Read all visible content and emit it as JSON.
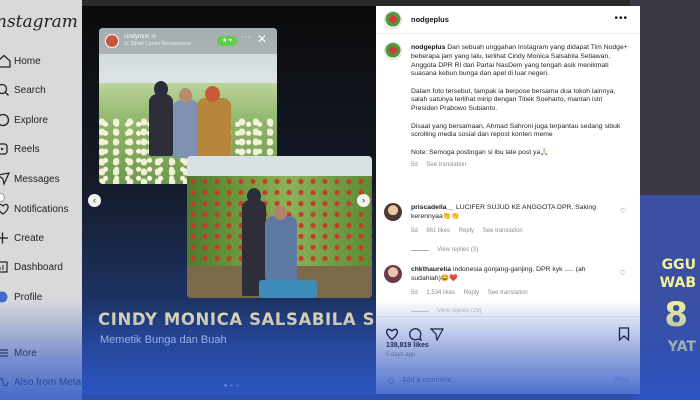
{
  "app": {
    "brand": "nstagram"
  },
  "nav": {
    "items": [
      {
        "label": "Home",
        "icon": "home-icon"
      },
      {
        "label": "Search",
        "icon": "search-icon"
      },
      {
        "label": "Explore",
        "icon": "compass-icon"
      },
      {
        "label": "Reels",
        "icon": "reels-icon"
      },
      {
        "label": "Messages",
        "icon": "messages-icon"
      },
      {
        "label": "Notifications",
        "icon": "heart-icon"
      },
      {
        "label": "Create",
        "icon": "plus-icon"
      },
      {
        "label": "Dashboard",
        "icon": "dashboard-icon"
      },
      {
        "label": "Profile",
        "icon": "profile-icon"
      },
      {
        "label": "More",
        "icon": "menu-icon"
      },
      {
        "label": "Also from Meta",
        "icon": "meta-icon"
      }
    ]
  },
  "media": {
    "story_user": "cindymnc",
    "story_time": "4h",
    "story_location": "Jl. Street Corner Renaissance",
    "caption_title": "CINDY MONICA SALSABILA SETIAWAN",
    "caption_subtitle": "Memetik Bunga dan Buah"
  },
  "post": {
    "username": "nodgeplus",
    "more": "•••",
    "caption_user": "nodgeplus",
    "caption_p1": "Dari sebuah unggahan Instagram yang didapat Tim Nodge+ beberapa jam yang lalu, terlihat Cindy Monica Salsabila Setiawan, Anggota DPR RI dari Partai NasDem yang tengah asik menikmati suasana kebun bunga dan apel di luar negeri.",
    "caption_p2": "Dalam foto tersebut, tampak ia berpose bersama dua tokoh lainnya, salah satunya terlihat mirip dengan Titiek Soeharto, mantan istri Presiden Prabowo Subianto.",
    "caption_p3": "Disaat yang bersamaan, Ahmad Sahroni juga terpantau sedang sibuk scrolling media sosial dan repost konten meme",
    "caption_p4": "Note: Semoga postingan si ibu late post ya🙏🏻",
    "caption_age": "5d",
    "see_translation": "See translation",
    "comments": [
      {
        "user": "priscadella__",
        "text": "LUCIFER SUJUD KE ANGGOTA DPR. Saking kerennyaa👏👏",
        "age": "5d",
        "likes": "861 likes",
        "reply": "Reply",
        "translation": "See translation",
        "view_replies": "View replies (3)"
      },
      {
        "user": "chkthaurelia",
        "text": "indonesia gonjang-ganjing, DPR kyk ..... (ah sudahlah)😂❤️",
        "age": "5d",
        "likes": "1,534 likes",
        "reply": "Reply",
        "translation": "See translation",
        "view_replies": "View replies (29)"
      }
    ],
    "likes_count": "138,819 likes",
    "time_ago": "5 days ago",
    "add_comment_placeholder": "Add a comment...",
    "post_label": "Post"
  },
  "background": {
    "poster_lines": [
      "GGU",
      "WAB",
      "8",
      "YAT"
    ]
  },
  "colors": {
    "caption_title": "#f5e7b0",
    "accent_blue": "#2a4ea0",
    "post_button": "#b6cff5"
  }
}
